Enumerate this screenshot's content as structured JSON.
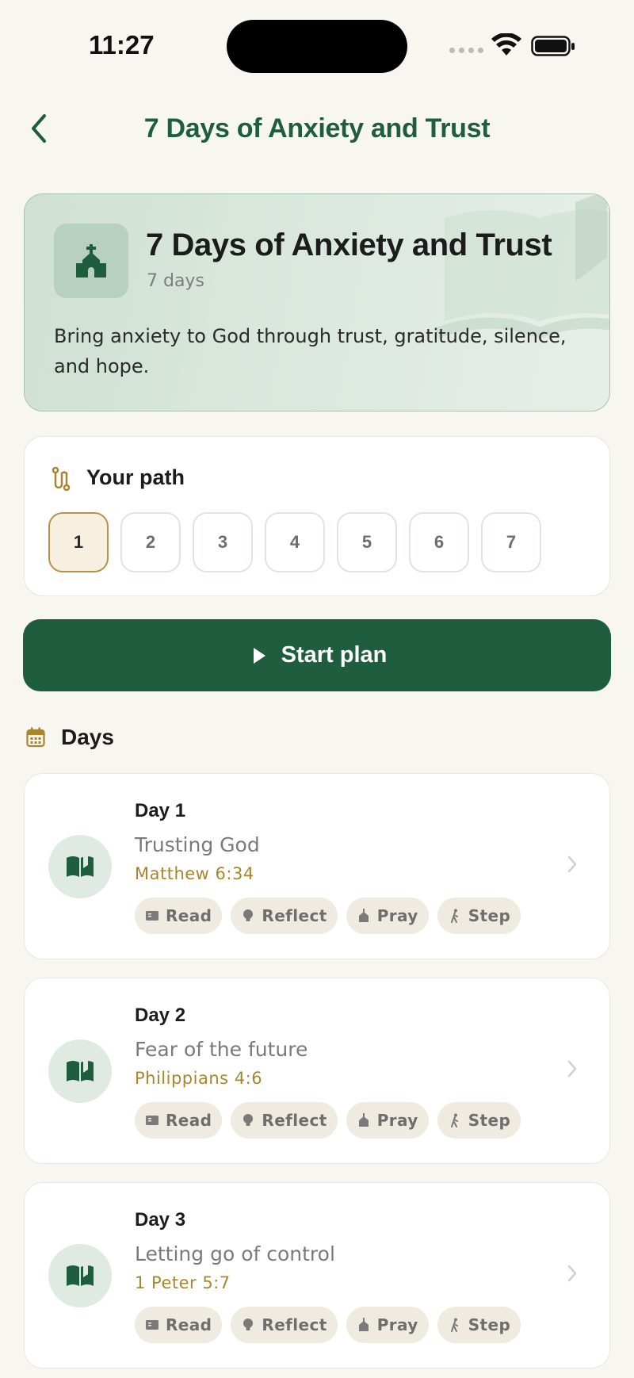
{
  "status_bar": {
    "time": "11:27"
  },
  "header": {
    "title": "7 Days of Anxiety and Trust"
  },
  "hero": {
    "title": "7 Days of Anxiety and Trust",
    "duration": "7 days",
    "description": "Bring anxiety to God through trust, gratitude, silence, and hope."
  },
  "path": {
    "title": "Your path",
    "steps": [
      "1",
      "2",
      "3",
      "4",
      "5",
      "6",
      "7"
    ],
    "active_step": "1"
  },
  "start_button": {
    "label": "Start plan"
  },
  "days_section": {
    "title": "Days"
  },
  "days": [
    {
      "label": "Day 1",
      "title": "Trusting God",
      "reference": "Matthew 6:34"
    },
    {
      "label": "Day 2",
      "title": "Fear of the future",
      "reference": "Philippians 4:6"
    },
    {
      "label": "Day 3",
      "title": "Letting go of control",
      "reference": "1 Peter 5:7"
    }
  ],
  "chips": {
    "read": "Read",
    "reflect": "Reflect",
    "pray": "Pray",
    "step": "Step"
  },
  "colors": {
    "accent_green": "#1e5e3f",
    "gold": "#a8862f",
    "background": "#f8f6f1"
  }
}
